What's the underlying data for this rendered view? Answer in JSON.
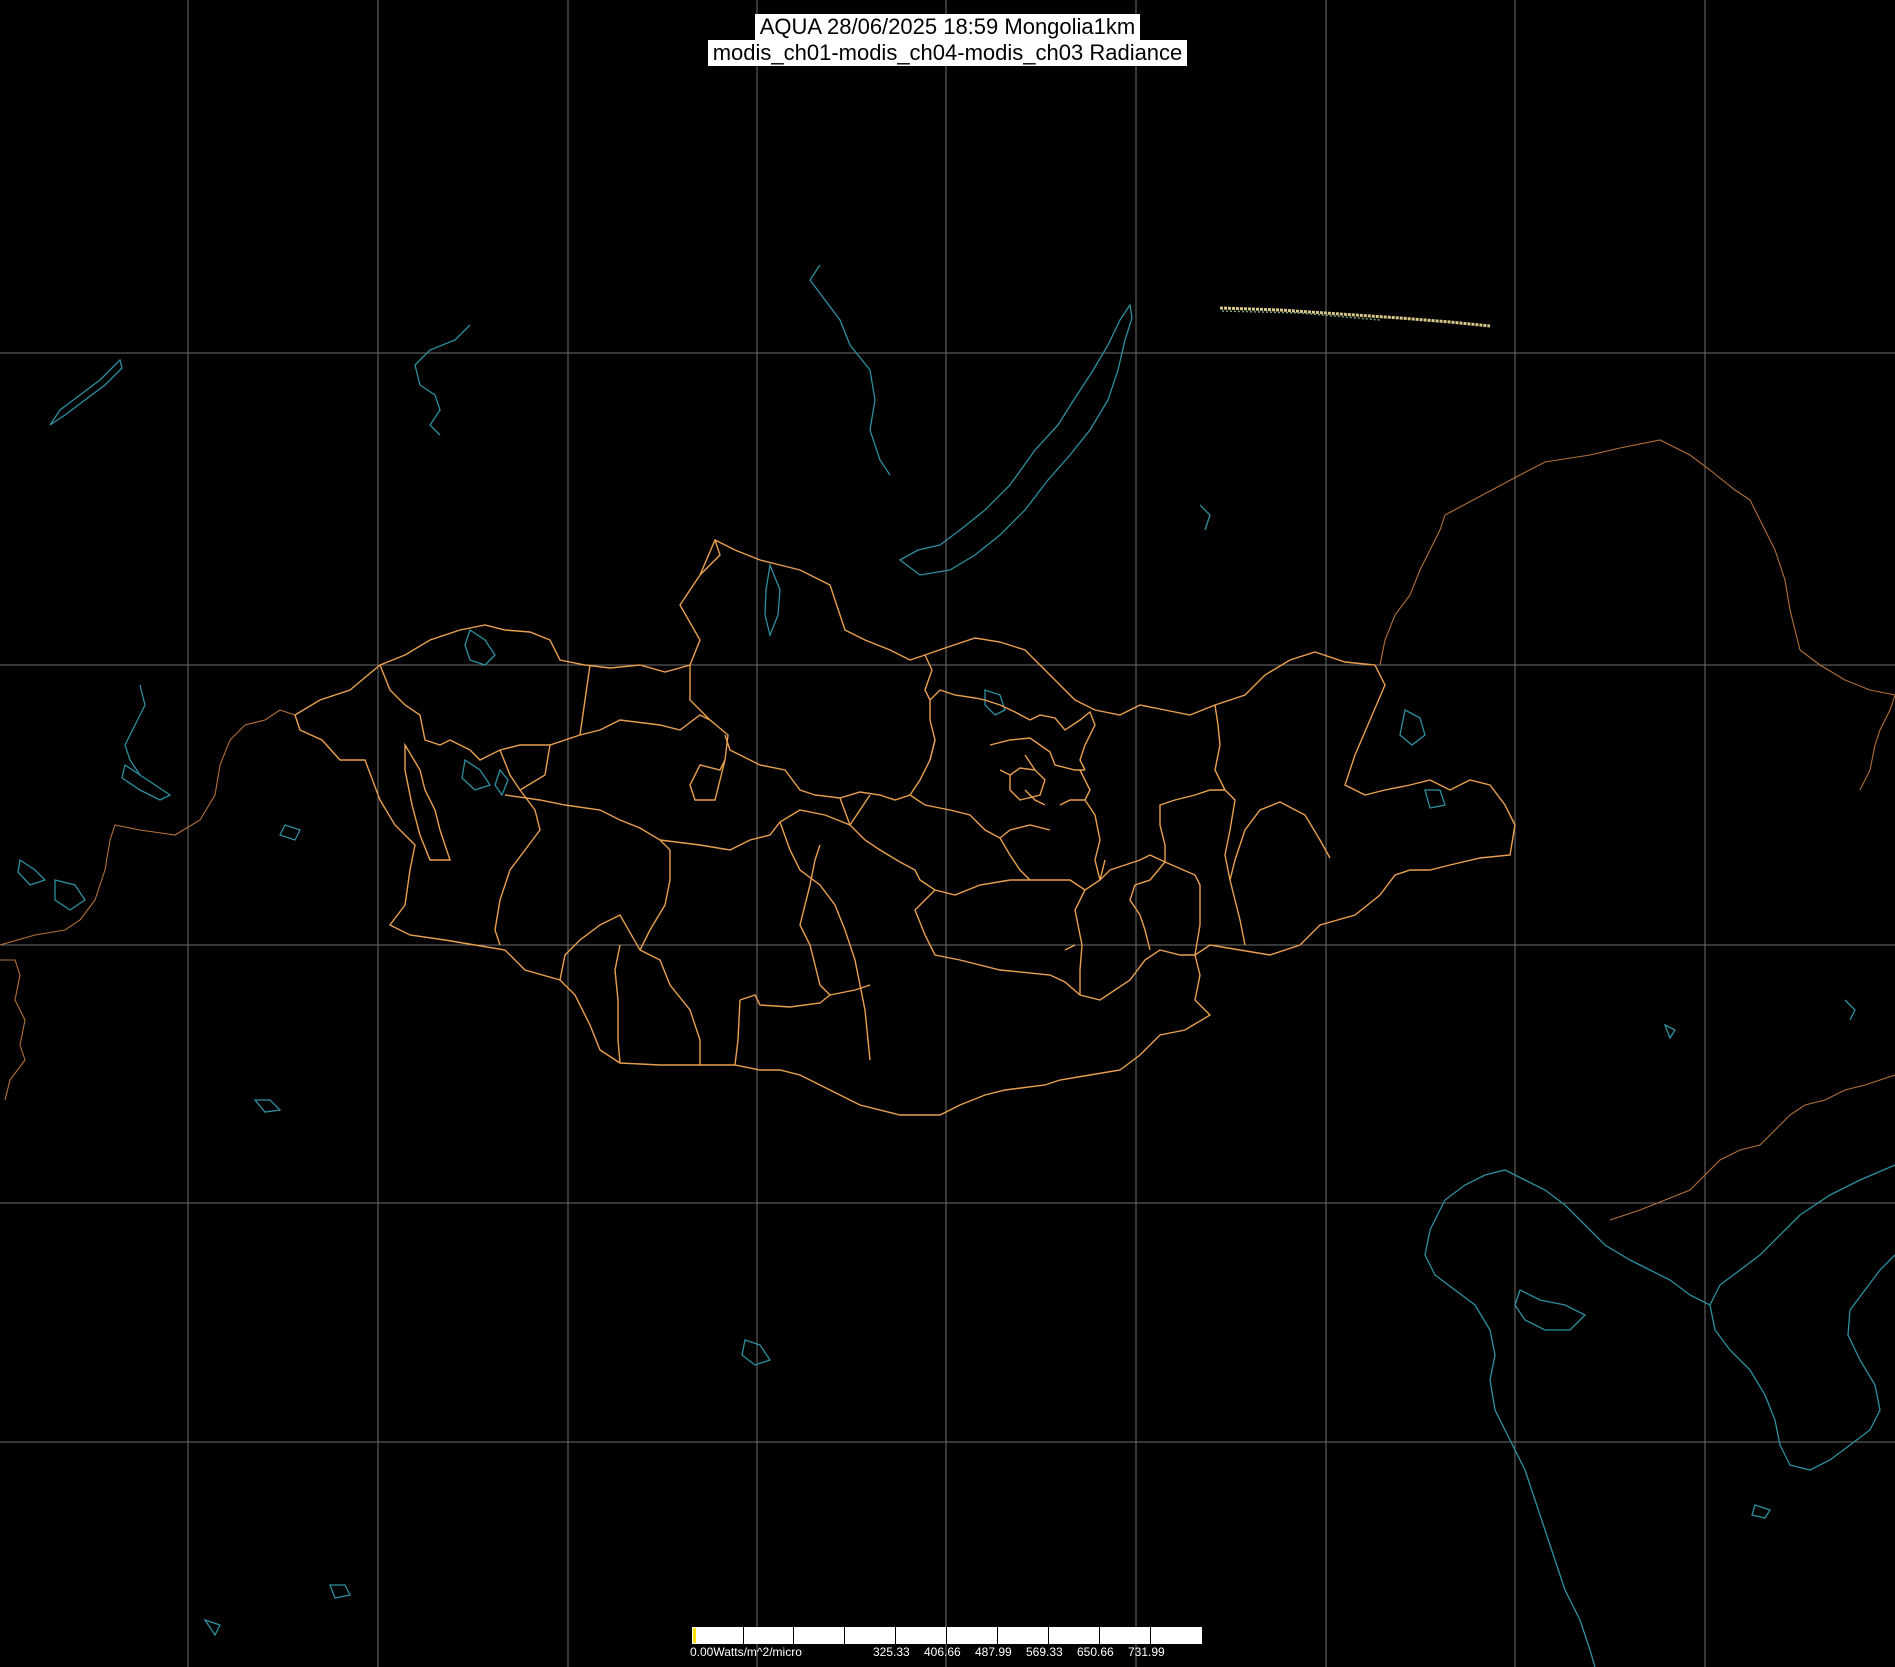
{
  "title": {
    "line1": "AQUA 28/06/2025 18:59 Mongolia1km",
    "line2": "modis_ch01-modis_ch04-modis_ch03 Radiance"
  },
  "colorbar": {
    "min_label": "0.00Watts/m^2/micro",
    "tick_labels": [
      "325.33",
      "406.66",
      "487.99",
      "569.33",
      "650.66",
      "731.99"
    ]
  },
  "colors": {
    "background": "#000000",
    "grid": "#6e6e6e",
    "mongolia_borders": "#e8a050",
    "country_borders": "#b0703a",
    "water": "#2e8fa0"
  },
  "layers": [
    "graticule",
    "coastlines-and-lakes",
    "mongolia-aimag-borders",
    "country-borders",
    "satellite-swath-fragment"
  ]
}
